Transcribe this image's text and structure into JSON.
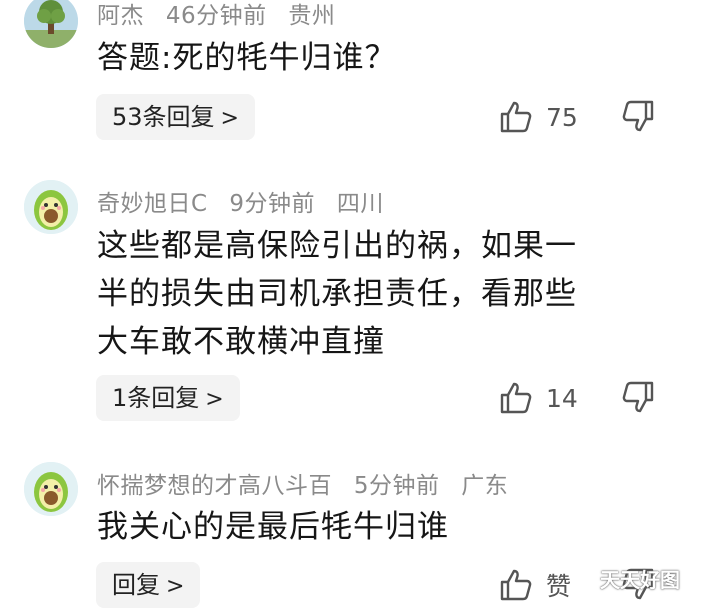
{
  "comments": [
    {
      "author": "阿杰",
      "time": "46分钟前",
      "location": "贵州",
      "lines": [
        "答题:死的牦牛归谁？"
      ],
      "reply_label": "53条回复",
      "like_count": "75",
      "avatar": "tree-avatar"
    },
    {
      "author": "奇妙旭日C",
      "time": "9分钟前",
      "location": "四川",
      "lines": [
        "这些都是高保险引出的祸，如果一",
        "半的损失由司机承担责任，看那些",
        "大车敢不敢横冲直撞"
      ],
      "reply_label": "1条回复",
      "like_count": "14",
      "avatar": "avocado-avatar"
    },
    {
      "author": "怀揣梦想的才高八斗百",
      "time": "5分钟前",
      "location": "广东",
      "lines": [
        "我关心的是最后牦牛归谁"
      ],
      "reply_label": "回复",
      "like_count": "赞",
      "avatar": "avocado-avatar"
    }
  ],
  "watermark": "天天好图",
  "colors": {
    "meta": "#8a8a8a",
    "text": "#161616",
    "reply_bg": "#f3f3f3"
  }
}
